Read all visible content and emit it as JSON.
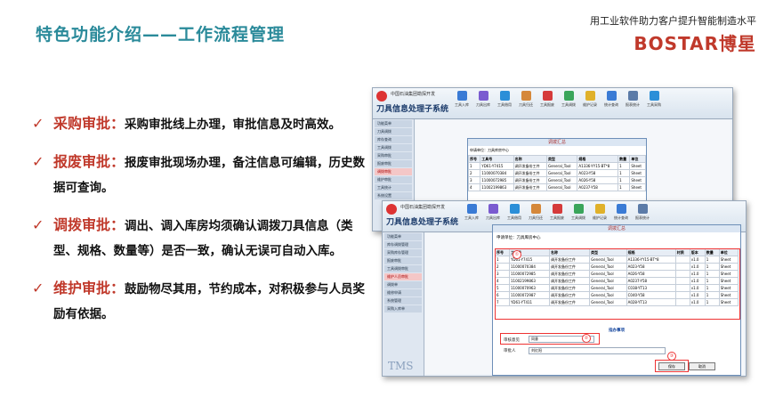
{
  "header": {
    "title": "特色功能介绍——工作流程管理",
    "slogan": "用工业软件助力客户提升智能制造水平",
    "logo": "BOSTAR博星"
  },
  "bullets": [
    {
      "head": "采购审批：",
      "body": "采购审批线上办理，审批信息及时高效。"
    },
    {
      "head": "报废审批：",
      "body": "报废审批现场办理，备注信息可编辑，历史数据可查询。"
    },
    {
      "head": "调拨审批：",
      "body": "调出、调入库房均须确认调拨刀具信息（类型、规格、数量等）是否一致，确认无误可自动入库。"
    },
    {
      "head": "维护审批：",
      "body": "鼓励物尽其用，节约成本，对积极参与人员奖励有依据。"
    }
  ],
  "app": {
    "company": "中国石油集团勘探开发",
    "title": "刀具信息处理子系统",
    "tools": [
      "工具入库",
      "刀具出库",
      "工具借用",
      "刀具归还",
      "工具报废",
      "工具调拨",
      "维护记录",
      "统计查询",
      "报表统计",
      "工具采购"
    ],
    "sidebar": [
      "功能菜单",
      "刀具调拨",
      "库存查询",
      "工具调拨",
      "采购审批",
      "报废审批",
      "调拨审批",
      "维护审批",
      "工具统计",
      "系统设置"
    ],
    "sidebar2": [
      "功能菜单",
      "库存调拨管理",
      "采购库存管理",
      "报废审批",
      "工具调拨审批",
      "维护人员审批",
      "调拨单",
      "维修申请",
      "系统管理",
      "采购入库单"
    ],
    "dialog_title": "调拨汇总",
    "dialog_info": "申请单位：刀具库房中心",
    "table_headers": [
      "序号",
      "工具号",
      "名称",
      "类型",
      "规格",
      "材质",
      "版本",
      "数量",
      "单位"
    ],
    "table_rows": [
      [
        "1",
        "YD61-Y7415",
        "调开发备份工件",
        "General_Tool",
        "A1336-YY15-BT*8",
        "v1.0",
        "1",
        "Sheet"
      ],
      [
        "2",
        "11000070384",
        "调开发备份工件",
        "General_Tool",
        "A023-Y58",
        "v1.0",
        "1",
        "Sheet"
      ],
      [
        "3",
        "11000072985",
        "调开发备份工件",
        "General_Tool",
        "A026-Y58",
        "v1.0",
        "1",
        "Sheet"
      ],
      [
        "4",
        "11002199863",
        "调开发备份工件",
        "General_Tool",
        "A0237-Y58",
        "v1.0",
        "1",
        "Sheet"
      ],
      [
        "5",
        "11000070963",
        "调开发备份工件",
        "General_Tool",
        "C038-YT13",
        "v1.0",
        "1",
        "Sheet"
      ],
      [
        "6",
        "11000072987",
        "调开发备份工件",
        "General_Tool",
        "C040-Y58",
        "v1.0",
        "1",
        "Sheet"
      ],
      [
        "7",
        "YD61-YT411",
        "调开发备份工件",
        "General_Tool",
        "A028-YT13",
        "v1.0",
        "1",
        "Sheet"
      ]
    ],
    "approve_label": "审核意见",
    "approve_value": "同意",
    "approver_label": "审批人",
    "approver_value": "刘红阳",
    "section_note": "指办事项",
    "ok_button": "保存",
    "cancel_button": "取消",
    "tms": "TMS"
  }
}
